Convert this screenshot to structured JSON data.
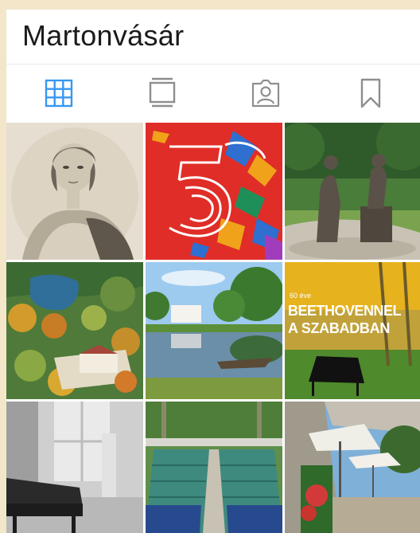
{
  "profile": {
    "username": "Martonvásár"
  },
  "tabs": [
    {
      "id": "grid",
      "icon": "grid-icon",
      "active": true
    },
    {
      "id": "feed",
      "icon": "feed-icon",
      "active": false
    },
    {
      "id": "tagged",
      "icon": "tagged-person-icon",
      "active": false
    },
    {
      "id": "saved",
      "icon": "bookmark-icon",
      "active": false
    }
  ],
  "colors": {
    "accent": "#3897f0",
    "inactive_icon": "#8e8e8e",
    "page_background": "#f3e6c9"
  },
  "posts": [
    {
      "id": "portrait-engraving"
    },
    {
      "id": "anniversary-50-poster"
    },
    {
      "id": "beethoven-statue"
    },
    {
      "id": "aerial-park-view"
    },
    {
      "id": "lake-reflection"
    },
    {
      "id": "beethoven-concert-poster",
      "caption_small": "60 éve",
      "caption_line1": "BEETHOVENNEL",
      "caption_line2": "A SZABADBAN"
    },
    {
      "id": "piano-room-bw"
    },
    {
      "id": "open-air-seating"
    },
    {
      "id": "courtyard-umbrellas"
    }
  ]
}
